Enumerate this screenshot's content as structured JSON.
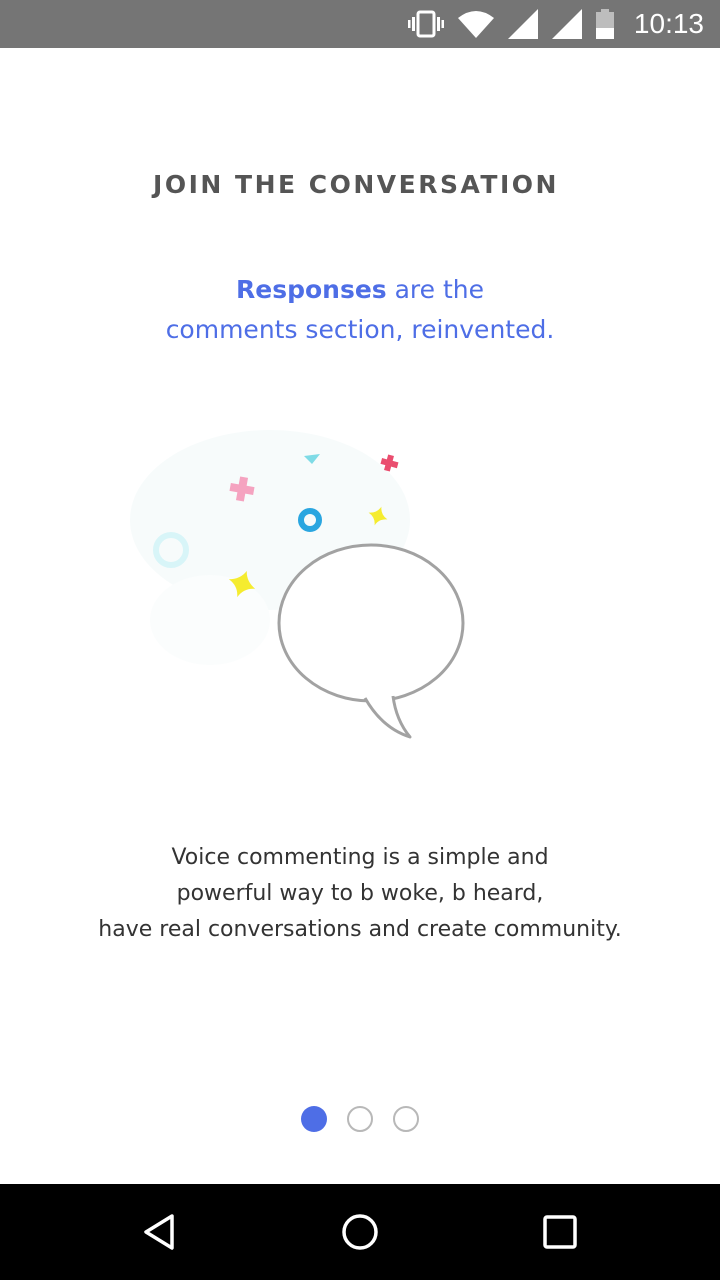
{
  "status_bar": {
    "time": "10:13",
    "icons": [
      "vibrate-icon",
      "wifi-icon",
      "signal-icon",
      "signal-icon",
      "battery-icon"
    ]
  },
  "onboarding": {
    "heading": "JOIN THE CONVERSATION",
    "subtitle_strong": "Responses",
    "subtitle_rest_line1": " are the",
    "subtitle_line2": "comments section, reinvented.",
    "body_lines": [
      "Voice commenting is a simple and",
      "powerful way to b woke, b heard,",
      "have real conversations and create community."
    ],
    "illustration": "speech-bubble-confetti",
    "pager": {
      "total": 3,
      "active": 1
    }
  },
  "nav_bar": {
    "buttons": [
      "back-icon",
      "home-icon",
      "recents-icon"
    ]
  },
  "colors": {
    "accent": "#4e6ee6",
    "status_bar": "#757575",
    "heading": "#555555",
    "body": "#333333"
  }
}
